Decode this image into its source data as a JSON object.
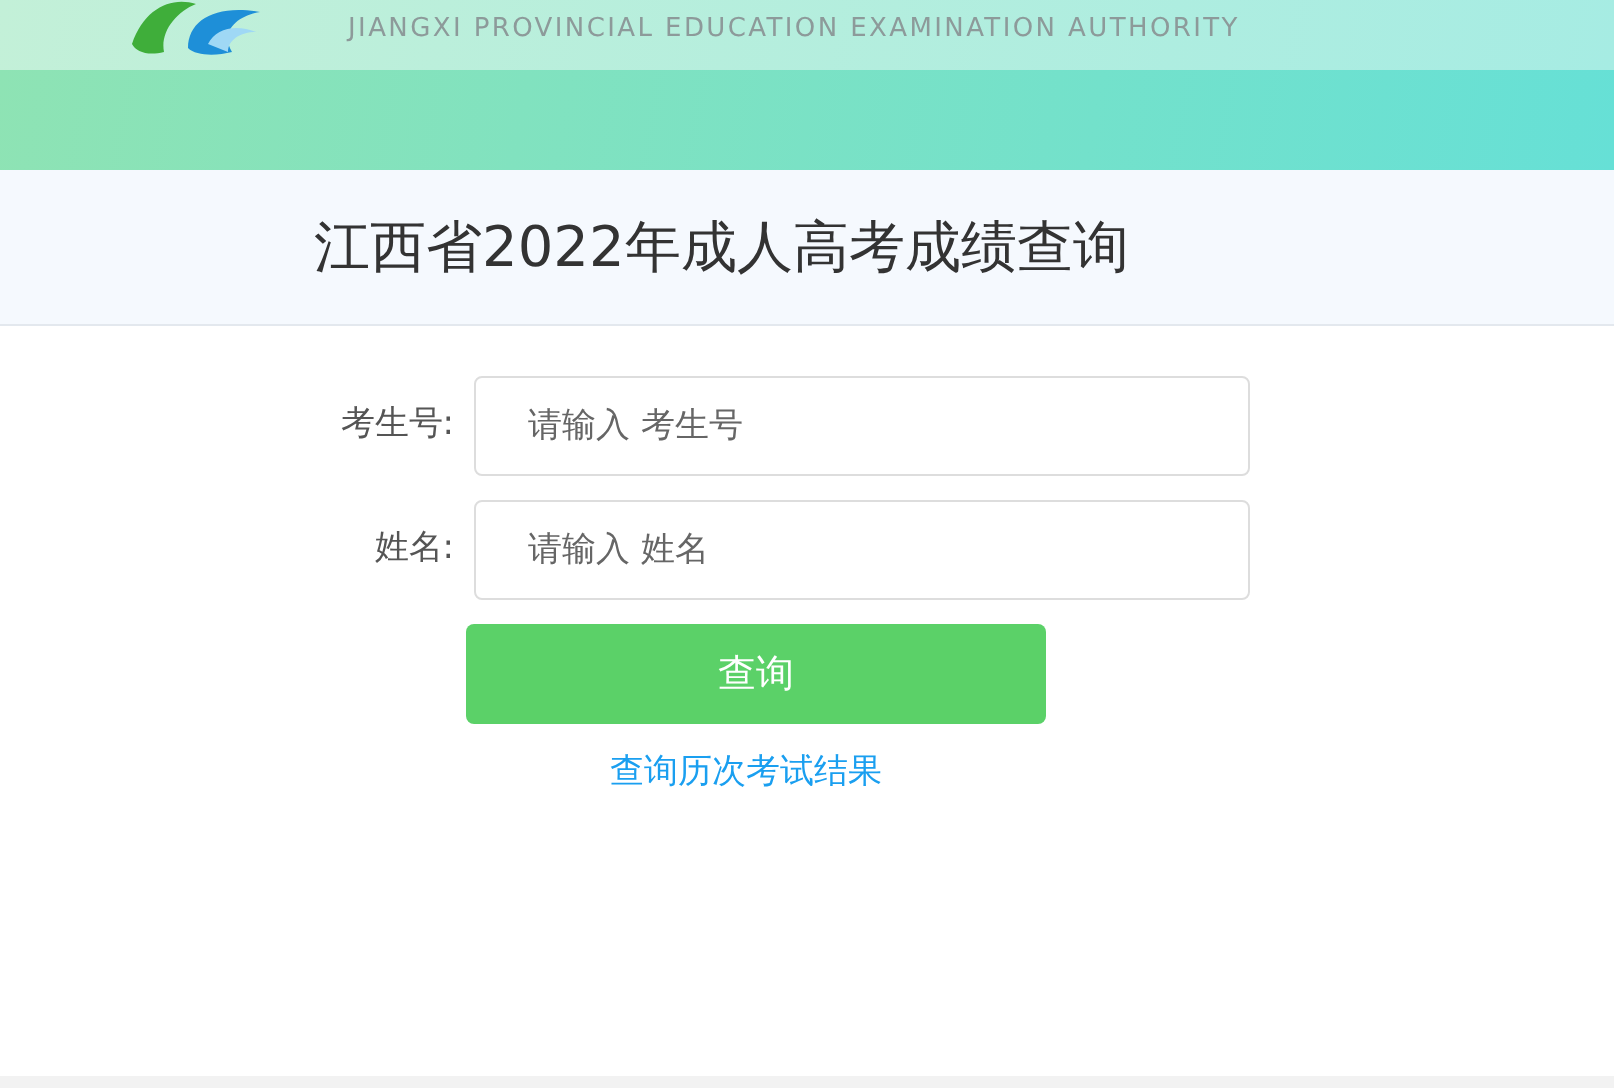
{
  "header": {
    "subtitle": "JIANGXI PROVINCIAL EDUCATION EXAMINATION AUTHORITY"
  },
  "page_title": "江西省2022年成人高考成绩查询",
  "form": {
    "fields": [
      {
        "label": "考生号:",
        "placeholder": "请输入 考生号"
      },
      {
        "label": "姓名:",
        "placeholder": "请输入 姓名"
      }
    ],
    "submit": "查询",
    "history_link": "查询历次考试结果"
  }
}
